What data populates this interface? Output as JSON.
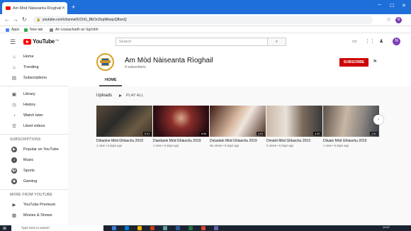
{
  "browser": {
    "tab_title": "Am Mòd Nàiseanta Rìoghail - Yo",
    "tab_close": "✕",
    "new_tab": "+",
    "url": "youtube.com/channel/UChG_BEOcDzpNbxqvQfbxsQ",
    "bookmarks": [
      "Apps",
      "New tab",
      "Air Leasachadh an Sgrìobh"
    ]
  },
  "youtube": {
    "logo_text": "YouTube",
    "logo_region": "GB",
    "search_placeholder": "Search"
  },
  "profile_initial": "N",
  "sidebar": {
    "main": [
      {
        "label": "Home",
        "icon": "home-icon",
        "glyph": "⌂"
      },
      {
        "label": "Trending",
        "icon": "flame-icon",
        "glyph": "♨"
      },
      {
        "label": "Subscriptions",
        "icon": "subscriptions-icon",
        "glyph": "▤"
      }
    ],
    "library": [
      {
        "label": "Library",
        "icon": "library-icon",
        "glyph": "▣"
      },
      {
        "label": "History",
        "icon": "history-icon",
        "glyph": "◷"
      },
      {
        "label": "Watch later",
        "icon": "clock-icon",
        "glyph": "◔"
      },
      {
        "label": "Liked videos",
        "icon": "thumbs-up-icon",
        "glyph": "☰"
      }
    ],
    "subscriptions_heading": "SUBSCRIPTIONS",
    "subscriptions": [
      {
        "label": "Popular on YouTube",
        "icon": "popular-icon",
        "glyph": "▶"
      },
      {
        "label": "Music",
        "icon": "music-icon",
        "glyph": "♪"
      },
      {
        "label": "Sports",
        "icon": "sports-icon",
        "glyph": "⚽"
      },
      {
        "label": "Gaming",
        "icon": "gaming-icon",
        "glyph": "◉"
      }
    ],
    "more_heading": "MORE FROM YOUTUBE",
    "more": [
      {
        "label": "YouTube Premium",
        "icon": "premium-icon",
        "glyph": "▶"
      },
      {
        "label": "Movies & Shows",
        "icon": "movies-icon",
        "glyph": "▦"
      }
    ]
  },
  "channel": {
    "name": "Am Mòd Nàiseanta Rìoghail",
    "subscribers": "4 subscribers",
    "subscribe_label": "SUBSCRIBE",
    "tab_home": "HOME",
    "uploads_label": "Uploads",
    "play_all_label": "PLAY ALL"
  },
  "videos": [
    {
      "title": "Dihaoine Mòd Ghlaschu 2019",
      "meta": "1 view • 6 days ago",
      "duration": "5:31"
    },
    {
      "title": "Diardaoin Mòd Ghlaschu 2019",
      "meta": "1 view • 6 days ago",
      "duration": "6:56"
    },
    {
      "title": "Diciadain Mòd Ghlaschu 2019",
      "meta": "No views • 6 days ago",
      "duration": "4:03"
    },
    {
      "title": "Dimàirt Mòd Ghlaschu 2019",
      "meta": "5 views • 6 days ago",
      "duration": "4:49"
    },
    {
      "title": "Diluain Mòd Ghlaschu 2019",
      "meta": "1 view • 6 days ago",
      "duration": "4:59"
    }
  ],
  "taskbar": {
    "search_placeholder": "Type here to search",
    "clock": "10:57"
  }
}
